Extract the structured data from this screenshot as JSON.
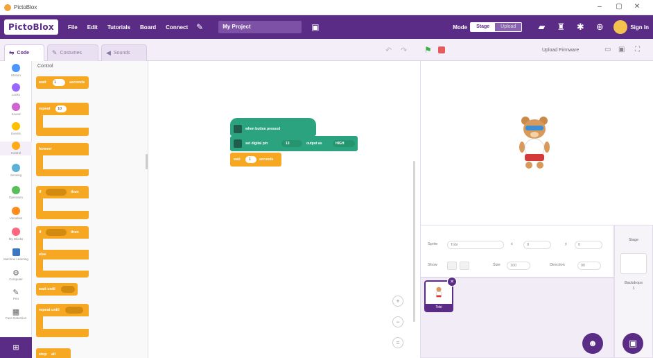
{
  "window": {
    "title": "PictoBlox",
    "controls": [
      "–",
      "▢",
      "✕"
    ]
  },
  "menubar": {
    "logo": "PictoBlox",
    "items": [
      "File",
      "Edit",
      "Tutorials",
      "Board",
      "Connect"
    ],
    "project_name": "My Project",
    "mode_label": "Mode",
    "mode_options": [
      "Stage",
      "Upload"
    ],
    "mode_selected": "Stage",
    "signin": "Sign In",
    "icons": [
      "pen-icon",
      "save-icon",
      "chat-icon",
      "bear-icon",
      "gear-icon",
      "globe-icon"
    ]
  },
  "tabs": {
    "code": "Code",
    "costumes": "Costumes",
    "sounds": "Sounds"
  },
  "stage_toolbar": {
    "upload_firmware": "Upload Firmware"
  },
  "categories": [
    {
      "label": "Motion",
      "color": "#4c97ff"
    },
    {
      "label": "Looks",
      "color": "#9966ff"
    },
    {
      "label": "Sound",
      "color": "#cf63cf"
    },
    {
      "label": "Events",
      "color": "#ffbf00"
    },
    {
      "label": "Control",
      "color": "#ffab19"
    },
    {
      "label": "Sensing",
      "color": "#5cb1d6"
    },
    {
      "label": "Operators",
      "color": "#59c059"
    },
    {
      "label": "Variables",
      "color": "#ff8c1a"
    },
    {
      "label": "My Blocks",
      "color": "#ff6680"
    },
    {
      "label": "Machine Learning",
      "color": "#3a77c3"
    },
    {
      "label": "Computer",
      "color": "#666666"
    },
    {
      "label": "Pen",
      "color": "#666666"
    },
    {
      "label": "Face Detection",
      "color": "#666666"
    }
  ],
  "palette": {
    "heading": "Control",
    "blocks": [
      {
        "label": "wait",
        "value": "1",
        "suffix": "seconds"
      },
      {
        "label": "repeat",
        "value": "10"
      },
      {
        "label": "forever"
      },
      {
        "label": "if",
        "suffix": "then"
      },
      {
        "label": "if",
        "suffix": "then",
        "else": "else"
      },
      {
        "label": "wait until"
      },
      {
        "label": "repeat until"
      },
      {
        "label": "stop",
        "value": "all"
      }
    ]
  },
  "script": {
    "blocks": [
      {
        "label": "when button pressed",
        "color": "#2aa37e"
      },
      {
        "label": "set digital pin",
        "pin": "13",
        "output": "HIGH"
      },
      {
        "label": "wait",
        "value": "1",
        "suffix": "seconds"
      }
    ],
    "zoom_controls": [
      "+",
      "−",
      "="
    ]
  },
  "sprite": {
    "labels": {
      "sprite": "Sprite",
      "x": "x",
      "y": "y",
      "show": "Show",
      "size": "Size",
      "direction": "Direction"
    },
    "name": "Tobi",
    "x": "0",
    "y": "0",
    "size": "100",
    "direction": "90",
    "thumb_name": "Tobi"
  },
  "stage_panel": {
    "label": "Stage",
    "backdrops_label": "Backdrops",
    "backdrops_count": "1"
  }
}
